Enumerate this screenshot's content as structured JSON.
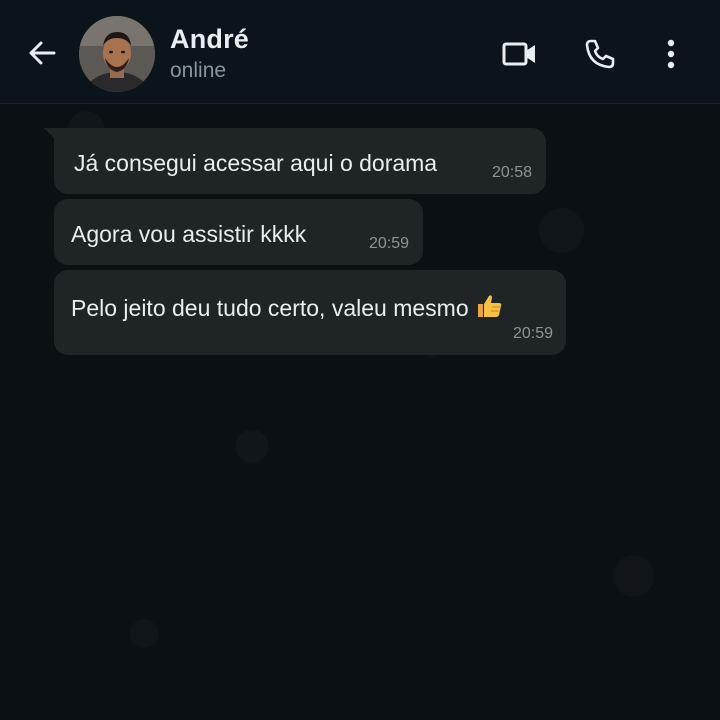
{
  "header": {
    "contact_name": "André",
    "status": "online",
    "icons": [
      "back-arrow-icon",
      "video-call-icon",
      "phone-icon",
      "more-vertical-icon"
    ]
  },
  "messages": [
    {
      "text": "Já consegui acessar aqui o dorama",
      "time": "20:58"
    },
    {
      "text": "Agora vou assistir kkkk",
      "time": "20:59"
    },
    {
      "text": "Pelo jeito deu tudo certo, valeu mesmo",
      "emoji": "thumbs-up-icon",
      "time": "20:59"
    }
  ],
  "colors": {
    "header_bg": "#0b141a",
    "chat_bg": "#0b1014",
    "bubble_bg": "#1f2427",
    "text": "#e9edef",
    "secondary_text": "#8696a0"
  }
}
